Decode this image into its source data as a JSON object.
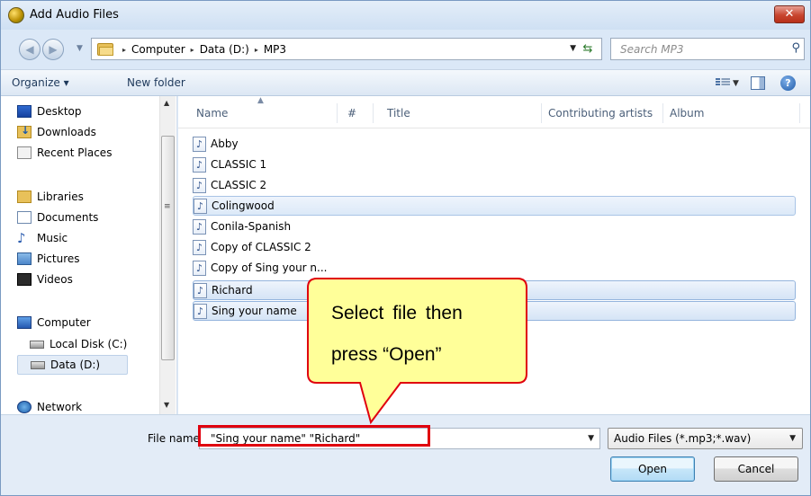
{
  "window": {
    "title": "Add Audio Files",
    "close_glyph": "✕"
  },
  "address": {
    "breadcrumbs": [
      "Computer",
      "Data (D:)",
      "MP3"
    ],
    "separator": "▸",
    "search_placeholder": "Search MP3"
  },
  "toolbar": {
    "organize_label": "Organize ▾",
    "new_folder_label": "New folder",
    "help_glyph": "?"
  },
  "nav": {
    "items": [
      {
        "label": "Desktop",
        "icon": "desktop-icon"
      },
      {
        "label": "Downloads",
        "icon": "downloads-icon"
      },
      {
        "label": "Recent Places",
        "icon": "recent-places-icon"
      },
      {
        "label": "Libraries",
        "icon": "libraries-icon"
      },
      {
        "label": "Documents",
        "icon": "documents-icon"
      },
      {
        "label": "Music",
        "icon": "music-icon"
      },
      {
        "label": "Pictures",
        "icon": "pictures-icon"
      },
      {
        "label": "Videos",
        "icon": "videos-icon"
      },
      {
        "label": "Computer",
        "icon": "computer-icon"
      },
      {
        "label": "Local Disk (C:)",
        "icon": "disk-icon"
      },
      {
        "label": "Data (D:)",
        "icon": "disk-icon"
      },
      {
        "label": "Network",
        "icon": "network-icon"
      }
    ],
    "selected": "Data (D:)"
  },
  "files": {
    "columns": [
      "Name",
      "#",
      "Title",
      "Contributing artists",
      "Album"
    ],
    "rows": [
      "Abby",
      "CLASSIC 1",
      "CLASSIC 2",
      "Colingwood",
      "Conila-Spanish",
      "Copy of CLASSIC 2",
      "Copy of Sing your n...",
      "Richard",
      "Sing your name"
    ],
    "selected": [
      "Richard",
      "Sing your name"
    ],
    "hovered": "Colingwood"
  },
  "bottom": {
    "file_name_label": "File name:",
    "file_name_value": "\"Sing your name\" \"Richard\"",
    "file_type_value": "Audio Files (*.mp3;*.wav)",
    "open_label": "Open",
    "cancel_label": "Cancel"
  },
  "callout": {
    "line1": "Select file then press “Open”",
    "line1_a": "Select file then",
    "line2": "press “Open”",
    "fill_color": "#ffff99",
    "border_color": "#e0000e"
  },
  "colors": {
    "highlight_red": "#e0000e",
    "accent_blue": "#3c7fb1"
  }
}
